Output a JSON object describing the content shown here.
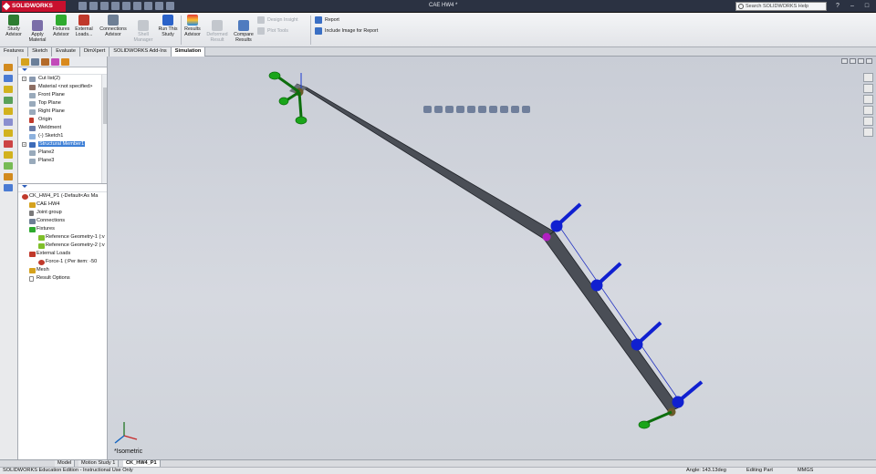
{
  "app": {
    "logo": "SOLIDWORKS",
    "window_title": "CAE HW4 *",
    "help_search_placeholder": "Search SOLIDWORKS Help",
    "window_buttons": [
      "?",
      "–",
      "□",
      "✕"
    ]
  },
  "ribbon": {
    "study_advisor": "Study Advisor",
    "apply_material": "Apply Material",
    "fixtures_advisor": "Fixtures Advisor",
    "external_loads": "External Loads...",
    "connections_advisor": "Connections Advisor",
    "shell_manager": "Shell Manager",
    "run_this_study": "Run This Study",
    "results_advisor": "Results Advisor",
    "deformed_result": "Deformed Result",
    "compare_results": "Compare Results",
    "design_insight": "Design Insight",
    "plot_tools": "Plot Tools",
    "report": "Report",
    "include_image": "Include Image for Report"
  },
  "tabs": [
    "Features",
    "Sketch",
    "Evaluate",
    "DimXpert",
    "SOLIDWORKS Add-Ins",
    "Simulation"
  ],
  "active_tab": "Simulation",
  "feature_tree": [
    {
      "label": "Cut list(2)",
      "expand": "+"
    },
    {
      "label": "Material <not specified>"
    },
    {
      "label": "Front Plane"
    },
    {
      "label": "Top Plane"
    },
    {
      "label": "Right Plane"
    },
    {
      "label": "Origin"
    },
    {
      "label": "Weldment"
    },
    {
      "label": "(-) Sketch1"
    },
    {
      "label": "Structural Member1",
      "expand": "+",
      "selected": true
    },
    {
      "label": "Plane2"
    },
    {
      "label": "Plane3"
    }
  ],
  "sim_tree": {
    "root": "CK_HW4_P1 (-Default<As Ma",
    "study": "CAE HW4",
    "joint_group": "Joint group",
    "connections": "Connections",
    "fixtures": "Fixtures",
    "ref_geom_1": "Reference Geometry-1 (:v",
    "ref_geom_2": "Reference Geometry-2 (:v",
    "external_loads": "External Loads",
    "force_1": "Force-1 (:Per item: -50",
    "mesh": "Mesh",
    "result_options": "Result Options"
  },
  "viewport": {
    "view_name": "*Isometric",
    "background_top": "#c9cdd6",
    "member_color": "#4a4e56",
    "fixture_color": "#1aa51a",
    "load_color": "#1020d0",
    "joint_color": "#b020c0"
  },
  "bottom_tabs": [
    "Model",
    "Motion Study 1",
    "CK_HW4_P1"
  ],
  "active_bottom_tab": "CK_HW4_P1",
  "status": {
    "edition": "SOLIDWORKS Education Edition - Instructional Use Only",
    "angle": "Angle: 143.13deg",
    "mode": "Editing Part",
    "units": "MMGS"
  }
}
